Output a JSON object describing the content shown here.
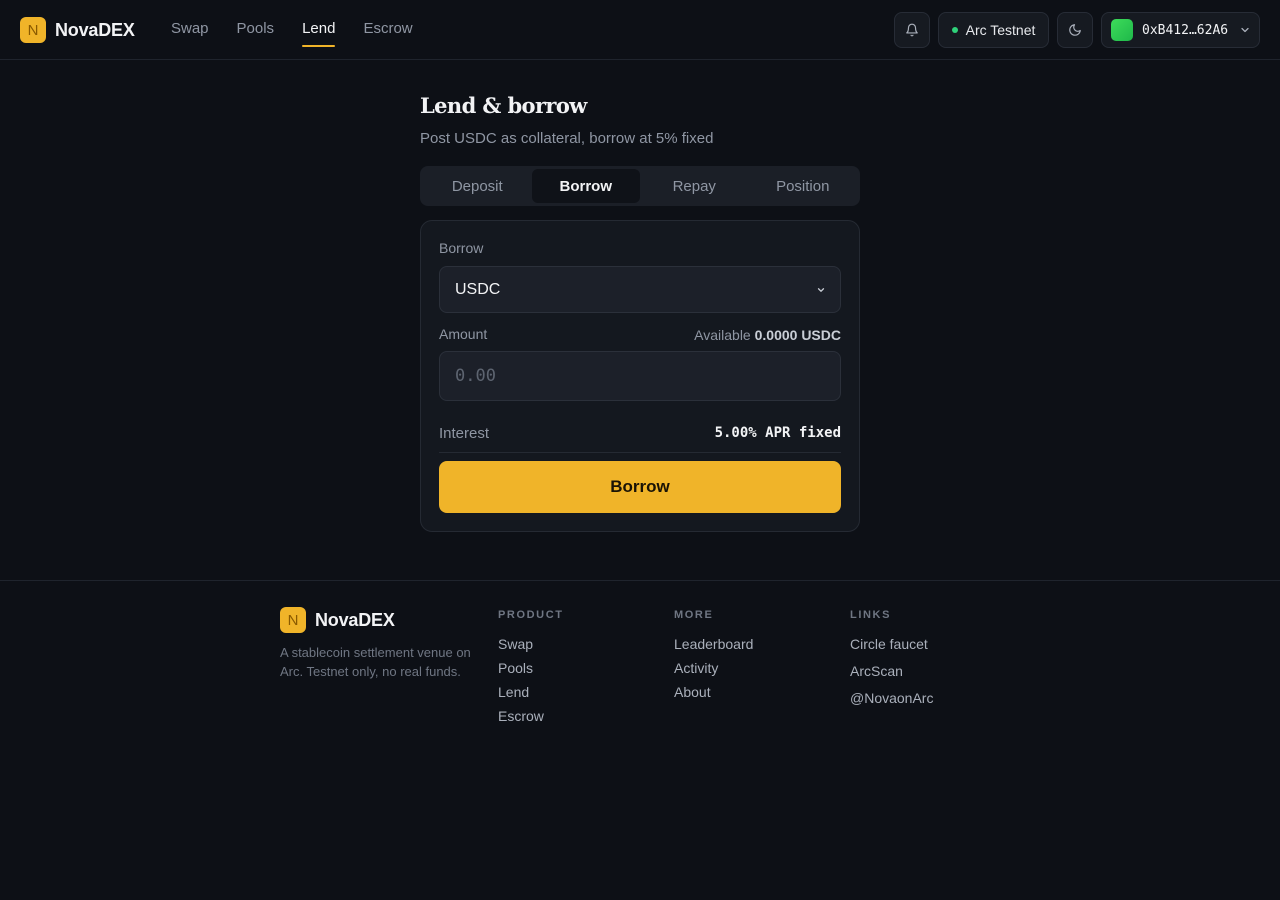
{
  "brand": {
    "logo_letter": "N",
    "name": "NovaDEX"
  },
  "nav": {
    "items": [
      "Swap",
      "Pools",
      "Lend",
      "Escrow"
    ],
    "active": "Lend"
  },
  "header": {
    "network_label": "Arc Testnet",
    "network_status_color": "#2fd17a",
    "wallet_address": "0xB412…62A6"
  },
  "page": {
    "title": "Lend & borrow",
    "subtitle": "Post USDC as collateral, borrow at 5% fixed"
  },
  "tabs": {
    "items": [
      "Deposit",
      "Borrow",
      "Repay",
      "Position"
    ],
    "active": "Borrow"
  },
  "form": {
    "borrow_label": "Borrow",
    "asset_selected": "USDC",
    "amount_label": "Amount",
    "available_label": "Available",
    "available_value": "0.0000 USDC",
    "amount_placeholder": "0.00",
    "interest_label": "Interest",
    "interest_value": "5.00% APR fixed",
    "submit_label": "Borrow"
  },
  "footer": {
    "logo_letter": "N",
    "name": "NovaDEX",
    "description": "A stablecoin settlement venue on Arc. Testnet only, no real funds.",
    "columns": [
      {
        "heading": "PRODUCT",
        "links": [
          "Swap",
          "Pools",
          "Lend",
          "Escrow"
        ]
      },
      {
        "heading": "MORE",
        "links": [
          "Leaderboard",
          "Activity",
          "About"
        ]
      },
      {
        "heading": "LINKS",
        "links": [
          "Circle faucet",
          "ArcScan",
          "@NovaonArc"
        ]
      }
    ]
  },
  "colors": {
    "accent": "#f0b429",
    "background": "#0d1016",
    "card": "#14181f"
  },
  "icons": {
    "notifications": "bell-icon",
    "theme": "moon-icon",
    "dropdown": "chevron-down-icon"
  }
}
